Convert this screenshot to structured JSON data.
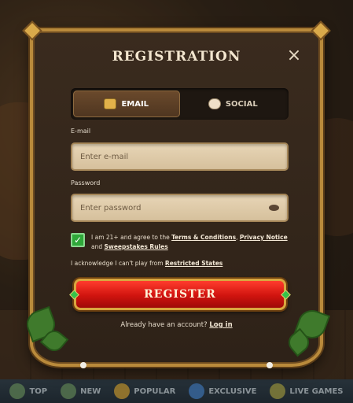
{
  "modal": {
    "title": "REGISTRATION",
    "close_icon": "×"
  },
  "tabs": [
    {
      "label": "EMAIL",
      "icon": "email-icon",
      "active": true
    },
    {
      "label": "SOCIAL",
      "icon": "chat-icon",
      "active": false
    }
  ],
  "email": {
    "label": "E-mail",
    "placeholder": "Enter e-mail",
    "value": ""
  },
  "password": {
    "label": "Password",
    "placeholder": "Enter password",
    "value": ""
  },
  "terms": {
    "checked": true,
    "prefix": "I am 21+ and agree to the ",
    "terms_link": "Terms & Conditions",
    "sep": ", ",
    "privacy_link": "Privacy Notice",
    "and": " and ",
    "sweepstakes_link": "Sweepstakes Rules"
  },
  "acknowledge": {
    "text": "I acknowledge I can't play from ",
    "link": "Restricted States"
  },
  "register_button": "REGISTER",
  "login": {
    "text": "Already have an account? ",
    "link": "Log in"
  },
  "bottom_nav": [
    {
      "label": "TOP",
      "icon": "top-icon"
    },
    {
      "label": "NEW",
      "icon": "new-icon"
    },
    {
      "label": "POPULAR",
      "icon": "popular-icon"
    },
    {
      "label": "EXCLUSIVE",
      "icon": "exclusive-icon"
    },
    {
      "label": "LIVE GAMES",
      "icon": "live-games-icon"
    }
  ],
  "colors": {
    "accent_gold": "#b98a3b",
    "register_red": "#d0140f",
    "checkbox_green": "#2fa83a"
  }
}
